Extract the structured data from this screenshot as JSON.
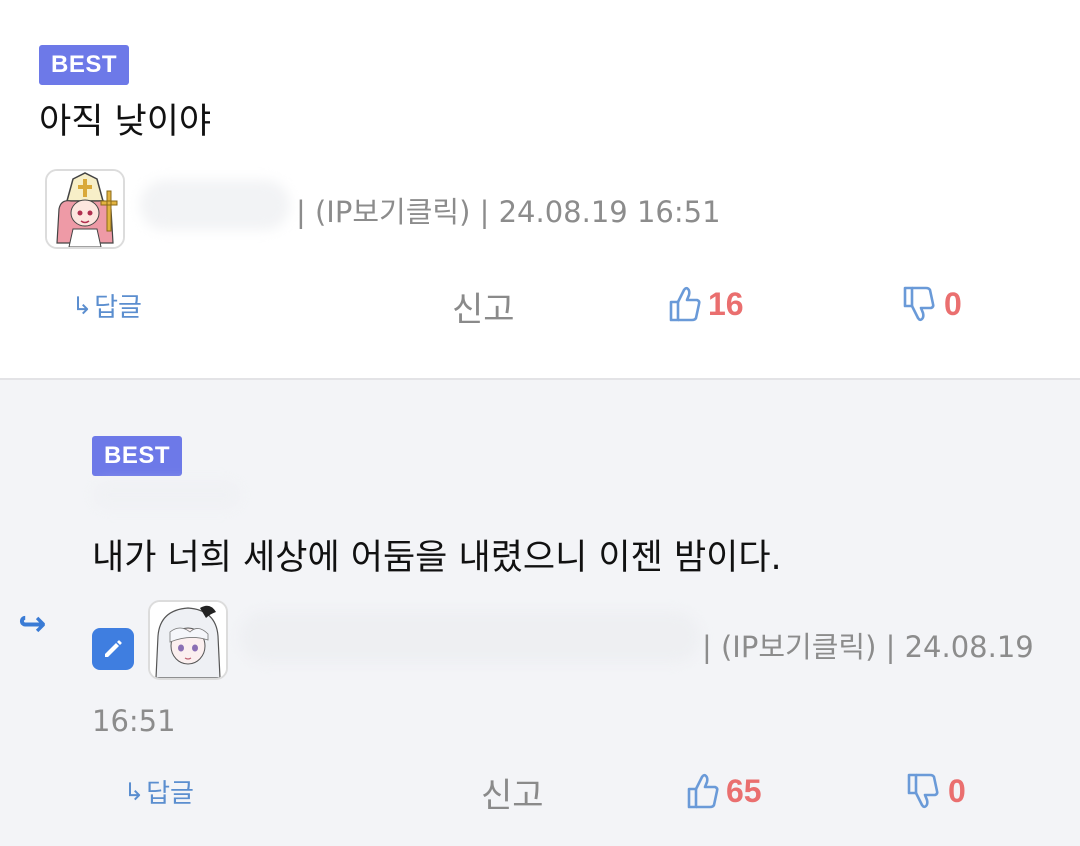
{
  "comments": [
    {
      "badge": "BEST",
      "content": "아직 낮이야",
      "meta": "| (IP보기클릭) | 24.08.19 16:51",
      "actions": {
        "reply_label": "답글",
        "report_label": "신고",
        "upvotes": "16",
        "downvotes": "0"
      }
    },
    {
      "badge": "BEST",
      "content": "내가 너희 세상에 어둠을 내렸으니 이젠 밤이다.",
      "meta_line1": "| (IP보기클릭) | 24.08.19",
      "meta_line2": "16:51",
      "actions": {
        "reply_label": "답글",
        "report_label": "신고",
        "upvotes": "65",
        "downvotes": "0"
      }
    }
  ],
  "icons": {
    "reply_arrow": "reply-arrow-icon",
    "thumbs_up": "thumbs-up-icon",
    "thumbs_down": "thumbs-down-icon",
    "edit": "pencil-icon",
    "reply_indicator": "reply-indicator-arrow-icon"
  },
  "colors": {
    "badge": "#6d79e8",
    "vote_count": "#ea6f6f",
    "thumb_icon": "#6a9ad8",
    "reply_link": "#5b8ecf",
    "reply_section_bg": "#f3f4f7"
  }
}
